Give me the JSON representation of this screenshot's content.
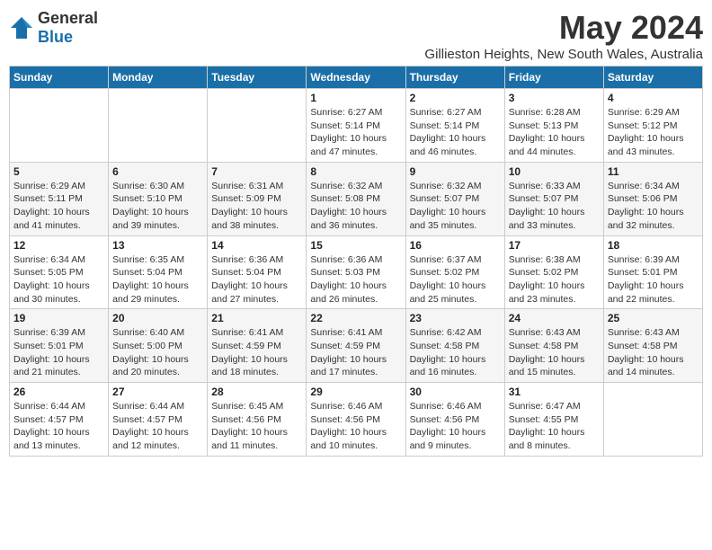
{
  "logo": {
    "general": "General",
    "blue": "Blue"
  },
  "title": "May 2024",
  "location": "Gillieston Heights, New South Wales, Australia",
  "days": [
    "Sunday",
    "Monday",
    "Tuesday",
    "Wednesday",
    "Thursday",
    "Friday",
    "Saturday"
  ],
  "weeks": [
    [
      {
        "date": "",
        "sunrise": "",
        "sunset": "",
        "daylight": ""
      },
      {
        "date": "",
        "sunrise": "",
        "sunset": "",
        "daylight": ""
      },
      {
        "date": "",
        "sunrise": "",
        "sunset": "",
        "daylight": ""
      },
      {
        "date": "1",
        "sunrise": "Sunrise: 6:27 AM",
        "sunset": "Sunset: 5:14 PM",
        "daylight": "Daylight: 10 hours and 47 minutes."
      },
      {
        "date": "2",
        "sunrise": "Sunrise: 6:27 AM",
        "sunset": "Sunset: 5:14 PM",
        "daylight": "Daylight: 10 hours and 46 minutes."
      },
      {
        "date": "3",
        "sunrise": "Sunrise: 6:28 AM",
        "sunset": "Sunset: 5:13 PM",
        "daylight": "Daylight: 10 hours and 44 minutes."
      },
      {
        "date": "4",
        "sunrise": "Sunrise: 6:29 AM",
        "sunset": "Sunset: 5:12 PM",
        "daylight": "Daylight: 10 hours and 43 minutes."
      }
    ],
    [
      {
        "date": "5",
        "sunrise": "Sunrise: 6:29 AM",
        "sunset": "Sunset: 5:11 PM",
        "daylight": "Daylight: 10 hours and 41 minutes."
      },
      {
        "date": "6",
        "sunrise": "Sunrise: 6:30 AM",
        "sunset": "Sunset: 5:10 PM",
        "daylight": "Daylight: 10 hours and 39 minutes."
      },
      {
        "date": "7",
        "sunrise": "Sunrise: 6:31 AM",
        "sunset": "Sunset: 5:09 PM",
        "daylight": "Daylight: 10 hours and 38 minutes."
      },
      {
        "date": "8",
        "sunrise": "Sunrise: 6:32 AM",
        "sunset": "Sunset: 5:08 PM",
        "daylight": "Daylight: 10 hours and 36 minutes."
      },
      {
        "date": "9",
        "sunrise": "Sunrise: 6:32 AM",
        "sunset": "Sunset: 5:07 PM",
        "daylight": "Daylight: 10 hours and 35 minutes."
      },
      {
        "date": "10",
        "sunrise": "Sunrise: 6:33 AM",
        "sunset": "Sunset: 5:07 PM",
        "daylight": "Daylight: 10 hours and 33 minutes."
      },
      {
        "date": "11",
        "sunrise": "Sunrise: 6:34 AM",
        "sunset": "Sunset: 5:06 PM",
        "daylight": "Daylight: 10 hours and 32 minutes."
      }
    ],
    [
      {
        "date": "12",
        "sunrise": "Sunrise: 6:34 AM",
        "sunset": "Sunset: 5:05 PM",
        "daylight": "Daylight: 10 hours and 30 minutes."
      },
      {
        "date": "13",
        "sunrise": "Sunrise: 6:35 AM",
        "sunset": "Sunset: 5:04 PM",
        "daylight": "Daylight: 10 hours and 29 minutes."
      },
      {
        "date": "14",
        "sunrise": "Sunrise: 6:36 AM",
        "sunset": "Sunset: 5:04 PM",
        "daylight": "Daylight: 10 hours and 27 minutes."
      },
      {
        "date": "15",
        "sunrise": "Sunrise: 6:36 AM",
        "sunset": "Sunset: 5:03 PM",
        "daylight": "Daylight: 10 hours and 26 minutes."
      },
      {
        "date": "16",
        "sunrise": "Sunrise: 6:37 AM",
        "sunset": "Sunset: 5:02 PM",
        "daylight": "Daylight: 10 hours and 25 minutes."
      },
      {
        "date": "17",
        "sunrise": "Sunrise: 6:38 AM",
        "sunset": "Sunset: 5:02 PM",
        "daylight": "Daylight: 10 hours and 23 minutes."
      },
      {
        "date": "18",
        "sunrise": "Sunrise: 6:39 AM",
        "sunset": "Sunset: 5:01 PM",
        "daylight": "Daylight: 10 hours and 22 minutes."
      }
    ],
    [
      {
        "date": "19",
        "sunrise": "Sunrise: 6:39 AM",
        "sunset": "Sunset: 5:01 PM",
        "daylight": "Daylight: 10 hours and 21 minutes."
      },
      {
        "date": "20",
        "sunrise": "Sunrise: 6:40 AM",
        "sunset": "Sunset: 5:00 PM",
        "daylight": "Daylight: 10 hours and 20 minutes."
      },
      {
        "date": "21",
        "sunrise": "Sunrise: 6:41 AM",
        "sunset": "Sunset: 4:59 PM",
        "daylight": "Daylight: 10 hours and 18 minutes."
      },
      {
        "date": "22",
        "sunrise": "Sunrise: 6:41 AM",
        "sunset": "Sunset: 4:59 PM",
        "daylight": "Daylight: 10 hours and 17 minutes."
      },
      {
        "date": "23",
        "sunrise": "Sunrise: 6:42 AM",
        "sunset": "Sunset: 4:58 PM",
        "daylight": "Daylight: 10 hours and 16 minutes."
      },
      {
        "date": "24",
        "sunrise": "Sunrise: 6:43 AM",
        "sunset": "Sunset: 4:58 PM",
        "daylight": "Daylight: 10 hours and 15 minutes."
      },
      {
        "date": "25",
        "sunrise": "Sunrise: 6:43 AM",
        "sunset": "Sunset: 4:58 PM",
        "daylight": "Daylight: 10 hours and 14 minutes."
      }
    ],
    [
      {
        "date": "26",
        "sunrise": "Sunrise: 6:44 AM",
        "sunset": "Sunset: 4:57 PM",
        "daylight": "Daylight: 10 hours and 13 minutes."
      },
      {
        "date": "27",
        "sunrise": "Sunrise: 6:44 AM",
        "sunset": "Sunset: 4:57 PM",
        "daylight": "Daylight: 10 hours and 12 minutes."
      },
      {
        "date": "28",
        "sunrise": "Sunrise: 6:45 AM",
        "sunset": "Sunset: 4:56 PM",
        "daylight": "Daylight: 10 hours and 11 minutes."
      },
      {
        "date": "29",
        "sunrise": "Sunrise: 6:46 AM",
        "sunset": "Sunset: 4:56 PM",
        "daylight": "Daylight: 10 hours and 10 minutes."
      },
      {
        "date": "30",
        "sunrise": "Sunrise: 6:46 AM",
        "sunset": "Sunset: 4:56 PM",
        "daylight": "Daylight: 10 hours and 9 minutes."
      },
      {
        "date": "31",
        "sunrise": "Sunrise: 6:47 AM",
        "sunset": "Sunset: 4:55 PM",
        "daylight": "Daylight: 10 hours and 8 minutes."
      },
      {
        "date": "",
        "sunrise": "",
        "sunset": "",
        "daylight": ""
      }
    ]
  ]
}
